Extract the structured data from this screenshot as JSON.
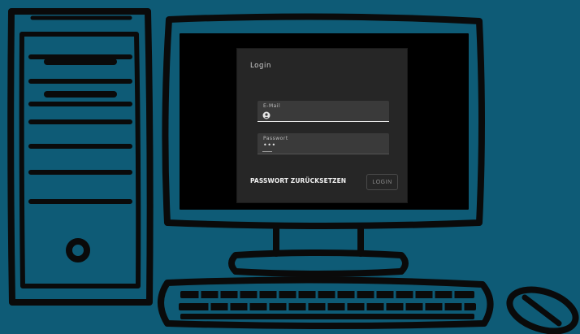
{
  "colors": {
    "background": "#0e5b76",
    "line": "#0a0a0a",
    "screen": "#000000",
    "dialog": "#262626",
    "field": "#3a3a3a"
  },
  "login": {
    "title": "Login",
    "email_label": "E-Mail",
    "password_label": "Passwort",
    "password_value": "•••",
    "reset_link": "PASSWORT ZURÜCKSETZEN",
    "login_button": "LOGIN"
  },
  "icons": {
    "email_field_icon": "user-icon"
  }
}
